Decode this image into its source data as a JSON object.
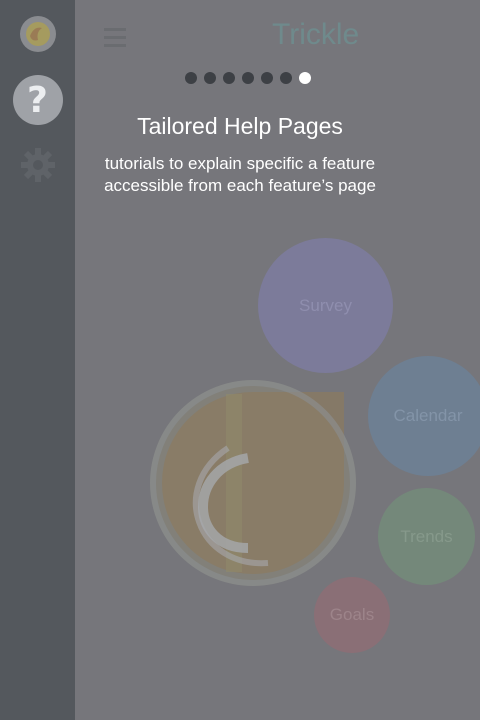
{
  "app": {
    "title": "Trickle"
  },
  "sidebar": {
    "items": [
      {
        "name": "app-logo",
        "icon": "trickle-logo-icon"
      },
      {
        "name": "help",
        "label": "?",
        "icon": "help-icon"
      },
      {
        "name": "settings",
        "icon": "gear-icon"
      }
    ]
  },
  "header": {
    "menu_icon": "hamburger-menu-icon"
  },
  "onboarding": {
    "total_pages": 7,
    "current_page": 7,
    "title": "Tailored Help Pages",
    "description": "tutorials to explain specific a feature accessible from each feature’s page"
  },
  "features": [
    {
      "label": "Survey",
      "color": "#7c7b9a"
    },
    {
      "label": "Calendar",
      "color": "#6e7f92"
    },
    {
      "label": "Trends",
      "color": "#74887a"
    },
    {
      "label": "Goals",
      "color": "#8a6f76"
    }
  ],
  "colors": {
    "overlay": "#76767b",
    "sidebar": "#54585d",
    "active_dot": "#ffffff",
    "inactive_dot": "#3d4045"
  }
}
